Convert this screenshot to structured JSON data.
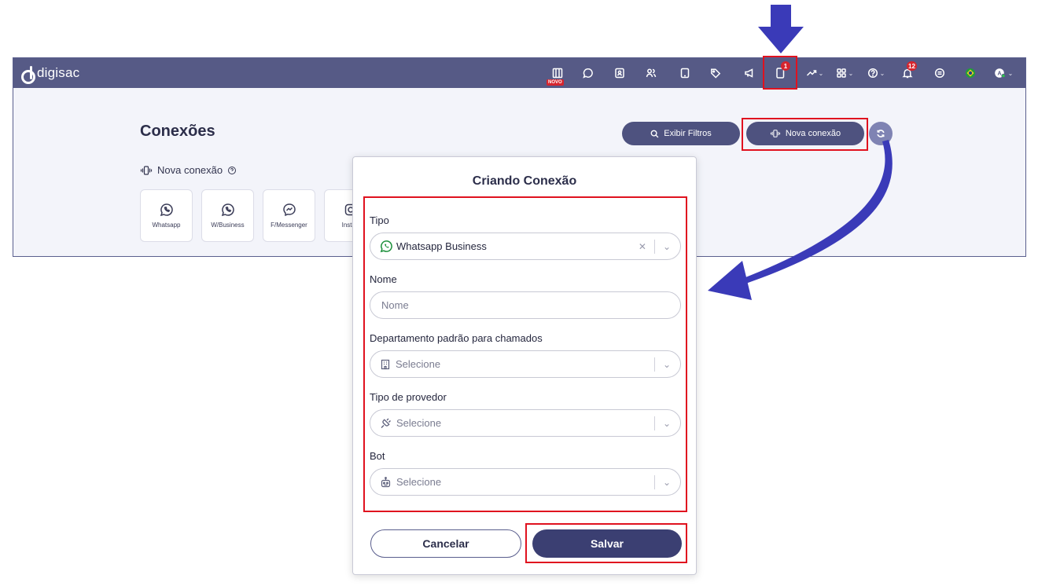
{
  "app": {
    "brand": "digisac",
    "page_title": "Conexões",
    "subhead": "Nova conexão",
    "filter_button": "Exibir Filtros",
    "new_connection_button": "Nova conexão"
  },
  "topbar": {
    "novo_badge": "NOVO",
    "connections_badge": "1",
    "notifications_badge": "12"
  },
  "tiles": [
    {
      "label": "Whatsapp",
      "icon": "whatsapp-icon"
    },
    {
      "label": "W/Business",
      "icon": "whatsapp-business-icon"
    },
    {
      "label": "F/Messenger",
      "icon": "messenger-icon"
    },
    {
      "label": "Instag",
      "icon": "instagram-icon"
    }
  ],
  "modal": {
    "title": "Criando Conexão",
    "tipo_label": "Tipo",
    "tipo_value": "Whatsapp Business",
    "nome_label": "Nome",
    "nome_placeholder": "Nome",
    "departamento_label": "Departamento padrão para chamados",
    "departamento_placeholder": "Selecione",
    "provedor_label": "Tipo de provedor",
    "provedor_placeholder": "Selecione",
    "bot_label": "Bot",
    "bot_placeholder": "Selecione",
    "cancel": "Cancelar",
    "save": "Salvar"
  },
  "colors": {
    "topbar": "#565a86",
    "primary": "#3b3f72",
    "highlight": "#e0121f",
    "arrow": "#3a3ab8"
  }
}
